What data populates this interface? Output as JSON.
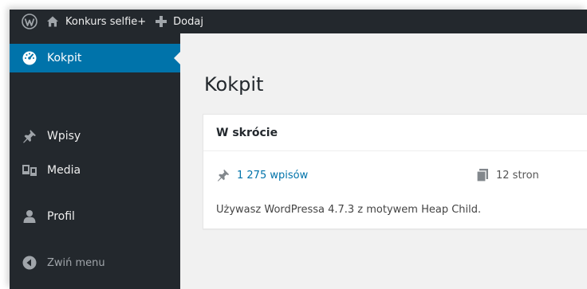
{
  "admin_bar": {
    "wp_logo_icon": "wordpress-logo-icon",
    "site_name": "Konkurs selfie+",
    "site_icon": "home-icon",
    "new_label": "Dodaj",
    "new_icon": "plus-icon"
  },
  "sidebar": {
    "items": [
      {
        "label": "Kokpit",
        "icon": "dashboard-icon",
        "current": true
      },
      {
        "label": "Wpisy",
        "icon": "pin-icon"
      },
      {
        "label": "Media",
        "icon": "media-icon"
      },
      {
        "label": "Profil",
        "icon": "user-icon"
      }
    ],
    "collapse_label": "Zwiń menu",
    "collapse_icon": "collapse-arrow-icon"
  },
  "main": {
    "title": "Kokpit",
    "at_a_glance": {
      "title": "W skrócie",
      "posts": "1 275 wpisów",
      "pages": "12 stron",
      "version_line": "Używasz WordPressa 4.7.3 z motywem Heap Child."
    }
  },
  "colors": {
    "admin_bar_bg": "#23282d",
    "sidebar_bg": "#23282d",
    "current_menu_bg": "#0073aa",
    "link": "#0073aa",
    "content_bg": "#f1f1f1"
  }
}
